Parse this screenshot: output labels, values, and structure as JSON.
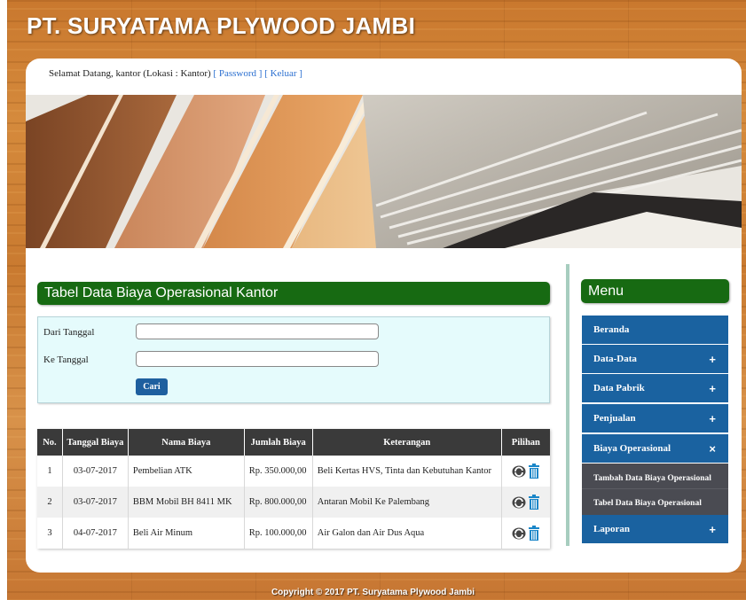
{
  "header": {
    "title": "PT. SURYATAMA PLYWOOD JAMBI",
    "welcome_text": "Selamat Datang, kantor (Lokasi : Kantor)",
    "password_link": "[ Password ]",
    "logout_link": "[ Keluar ]"
  },
  "main": {
    "section_title": "Tabel Data Biaya Operasional Kantor",
    "form": {
      "from_label": "Dari Tanggal",
      "from_value": "",
      "to_label": "Ke Tanggal",
      "to_value": "",
      "search_button": "Cari"
    },
    "table": {
      "headers": [
        "No.",
        "Tanggal Biaya",
        "Nama Biaya",
        "Jumlah Biaya",
        "Keterangan",
        "Pilihan"
      ],
      "rows": [
        {
          "no": "1",
          "tanggal": "03-07-2017",
          "nama": "Pembelian ATK",
          "jumlah": "Rp. 350.000,00",
          "keterangan": "Beli Kertas HVS, Tinta dan Kebutuhan Kantor"
        },
        {
          "no": "2",
          "tanggal": "03-07-2017",
          "nama": "BBM Mobil BH 8411 MK",
          "jumlah": "Rp. 800.000,00",
          "keterangan": "Antaran Mobil Ke Palembang"
        },
        {
          "no": "3",
          "tanggal": "04-07-2017",
          "nama": "Beli Air Minum",
          "jumlah": "Rp. 100.000,00",
          "keterangan": "Air Galon dan Air Dus Aqua"
        }
      ]
    }
  },
  "sidebar": {
    "title": "Menu",
    "items": [
      {
        "label": "Beranda",
        "sign": ""
      },
      {
        "label": "Data-Data",
        "sign": "+"
      },
      {
        "label": "Data Pabrik",
        "sign": "+"
      },
      {
        "label": "Penjualan",
        "sign": "+"
      },
      {
        "label": "Biaya Operasional",
        "sign": "×"
      },
      {
        "label": "Laporan",
        "sign": "+"
      }
    ],
    "subitems": [
      {
        "label": "Tambah Data Biaya Operasional"
      },
      {
        "label": "Tabel Data Biaya Operasional"
      }
    ]
  },
  "footer": {
    "copyright": "Copyright © 2017 PT. Suryatama Plywood Jambi"
  },
  "colors": {
    "header_green": "#176a12",
    "menu_blue": "#1a62a0",
    "submenu_gray": "#4a4b52",
    "table_header": "#3a3a3a",
    "form_bg": "#e5fbfc"
  },
  "icons": {
    "edit": "edit-icon",
    "delete": "trash-icon"
  }
}
